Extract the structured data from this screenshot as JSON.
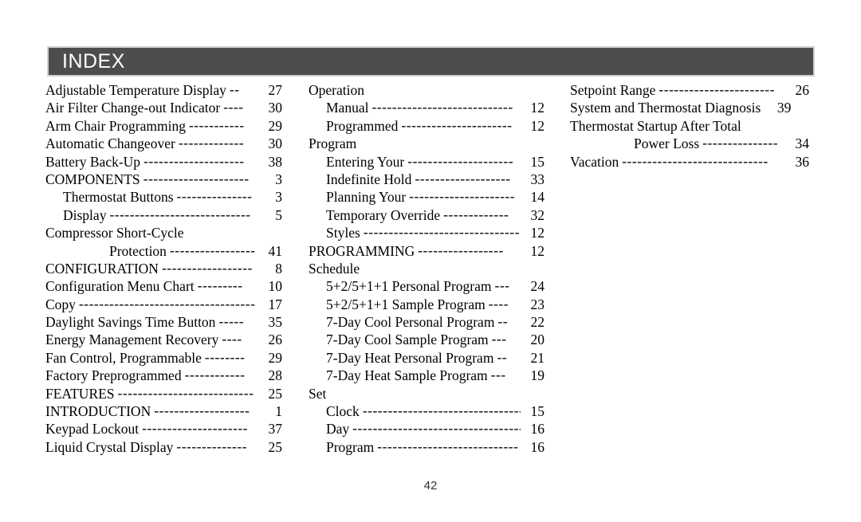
{
  "header": {
    "title": "INDEX"
  },
  "folio": {
    "page_number": "42"
  },
  "colors": {
    "header_bar": "#4d4d4d",
    "header_text": "#ffffff",
    "header_border": "#d0d0d0",
    "page_background": "#ffffff",
    "body_text": "#000000"
  },
  "columns": [
    {
      "name": "column-1",
      "entries": [
        {
          "label": "Adjustable Temperature Display",
          "leader": "--",
          "page": "27",
          "indent": 0
        },
        {
          "label": "Air Filter Change-out Indicator",
          "leader": "----",
          "page": "30",
          "indent": 0
        },
        {
          "label": "Arm Chair Programming",
          "leader": "-----------",
          "page": "29",
          "indent": 0
        },
        {
          "label": "Automatic Changeover",
          "leader": "-------------",
          "page": "30",
          "indent": 0
        },
        {
          "label": "Battery Back-Up",
          "leader": "--------------------",
          "page": "38",
          "indent": 0
        },
        {
          "label": "COMPONENTS",
          "leader": "---------------------",
          "page": "3",
          "indent": 0
        },
        {
          "label": "Thermostat Buttons",
          "leader": "---------------",
          "page": "3",
          "indent": 1
        },
        {
          "label": "Display",
          "leader": "----------------------------",
          "page": "5",
          "indent": 1
        },
        {
          "label": "Compressor Short-Cycle",
          "leader": "",
          "page": "",
          "indent": 0,
          "heading": true
        },
        {
          "label": "Protection",
          "leader": "-----------------",
          "page": "41",
          "indent": 2
        },
        {
          "label": "CONFIGURATION",
          "leader": "------------------",
          "page": "8",
          "indent": 0
        },
        {
          "label": "Configuration Menu Chart",
          "leader": "---------",
          "page": "10",
          "indent": 0
        },
        {
          "label": "Copy",
          "leader": "-----------------------------------",
          "page": "17",
          "indent": 0
        },
        {
          "label": "Daylight Savings Time Button",
          "leader": "-----",
          "page": "35",
          "indent": 0
        },
        {
          "label": "Energy Management Recovery",
          "leader": "----",
          "page": "26",
          "indent": 0
        },
        {
          "label": "Fan Control, Programmable",
          "leader": "--------",
          "page": "29",
          "indent": 0
        },
        {
          "label": "Factory Preprogrammed",
          "leader": "------------",
          "page": "28",
          "indent": 0
        },
        {
          "label": "FEATURES",
          "leader": "---------------------------",
          "page": "25",
          "indent": 0
        },
        {
          "label": "INTRODUCTION",
          "leader": "-------------------",
          "page": "1",
          "indent": 0
        },
        {
          "label": "Keypad Lockout",
          "leader": "---------------------",
          "page": "37",
          "indent": 0
        },
        {
          "label": "Liquid Crystal Display",
          "leader": "--------------",
          "page": "25",
          "indent": 0
        }
      ]
    },
    {
      "name": "column-2",
      "entries": [
        {
          "label": "Operation",
          "leader": "",
          "page": "",
          "indent": 0,
          "heading": true
        },
        {
          "label": "Manual",
          "leader": "----------------------------",
          "page": "12",
          "indent": 1
        },
        {
          "label": "Programmed",
          "leader": "----------------------",
          "page": "12",
          "indent": 1
        },
        {
          "label": "Program",
          "leader": "",
          "page": "",
          "indent": 0,
          "heading": true
        },
        {
          "label": "Entering Your",
          "leader": "---------------------",
          "page": "15",
          "indent": 1
        },
        {
          "label": "Indefinite Hold",
          "leader": "-------------------",
          "page": "33",
          "indent": 1
        },
        {
          "label": "Planning Your",
          "leader": "---------------------",
          "page": "14",
          "indent": 1
        },
        {
          "label": "Temporary Override",
          "leader": "-------------",
          "page": "32",
          "indent": 1
        },
        {
          "label": "Styles",
          "leader": "-------------------------------",
          "page": "12",
          "indent": 1
        },
        {
          "label": "PROGRAMMING",
          "leader": "-----------------",
          "page": "12",
          "indent": 0
        },
        {
          "label": "Schedule",
          "leader": "",
          "page": "",
          "indent": 0,
          "heading": true
        },
        {
          "label": "5+2/5+1+1 Personal Program",
          "leader": "---",
          "page": "24",
          "indent": 1
        },
        {
          "label": "5+2/5+1+1 Sample Program",
          "leader": "----",
          "page": "23",
          "indent": 1
        },
        {
          "label": "7-Day Cool Personal Program",
          "leader": "--",
          "page": "22",
          "indent": 1
        },
        {
          "label": "7-Day Cool Sample Program",
          "leader": "---",
          "page": "20",
          "indent": 1
        },
        {
          "label": "7-Day Heat Personal Program",
          "leader": "--",
          "page": "21",
          "indent": 1
        },
        {
          "label": "7-Day Heat Sample Program",
          "leader": "---",
          "page": "19",
          "indent": 1
        },
        {
          "label": "Set",
          "leader": "",
          "page": "",
          "indent": 0,
          "heading": true
        },
        {
          "label": "Clock",
          "leader": "--------------------------------",
          "page": "15",
          "indent": 1
        },
        {
          "label": "Day",
          "leader": "----------------------------------",
          "page": "16",
          "indent": 1
        },
        {
          "label": "Program",
          "leader": "----------------------------",
          "page": "16",
          "indent": 1
        }
      ]
    },
    {
      "name": "column-3",
      "entries": [
        {
          "label": "Setpoint Range",
          "leader": "-----------------------",
          "page": "26",
          "indent": 0
        },
        {
          "label": "System and Thermostat Diagnosis",
          "leader": "",
          "page": "39",
          "indent": 0,
          "no_leader": true
        },
        {
          "label": "Thermostat Startup After Total",
          "leader": "",
          "page": "",
          "indent": 0,
          "heading": true
        },
        {
          "label": "Power Loss",
          "leader": "---------------",
          "page": "34",
          "indent": 2
        },
        {
          "label": "Vacation",
          "leader": "-----------------------------",
          "page": "36",
          "indent": 0
        }
      ]
    }
  ]
}
